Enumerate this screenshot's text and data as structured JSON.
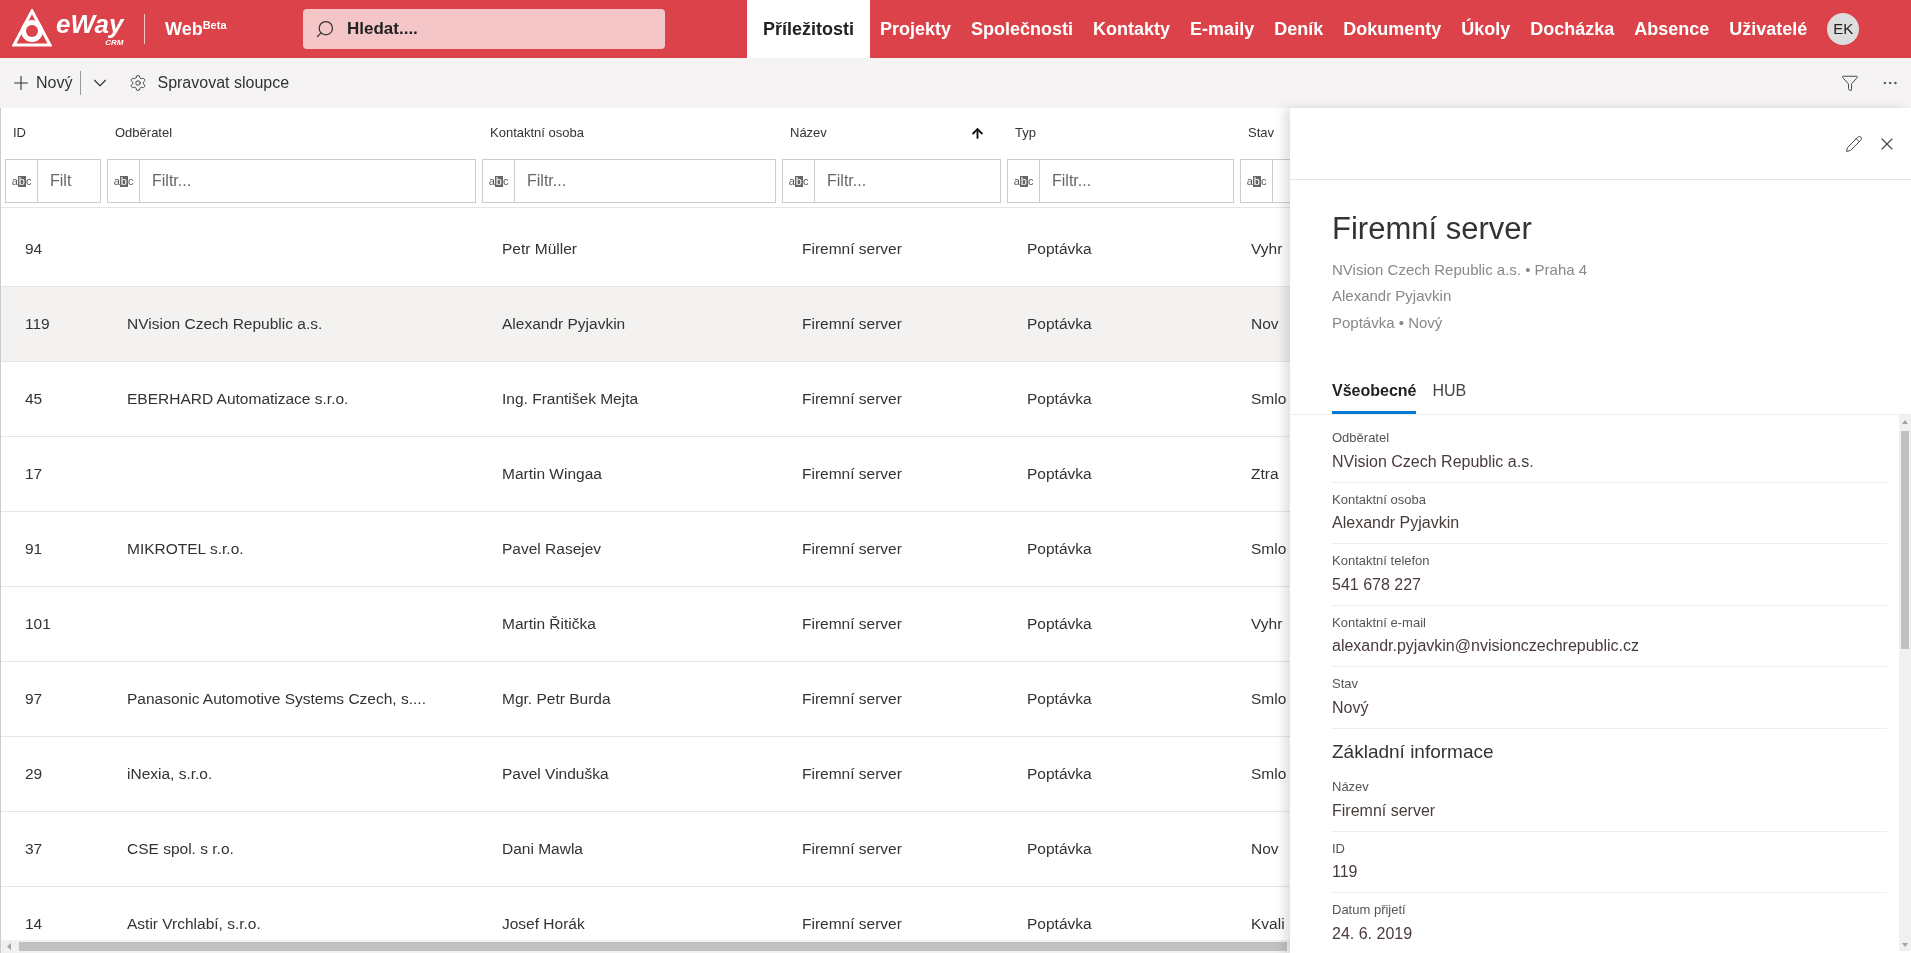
{
  "logo": {
    "name": "eWay",
    "sub": "CRM"
  },
  "product": "Web$^{Beta}$",
  "search": {
    "placeholder": "Hledat...."
  },
  "nav": [
    {
      "label": "Příležitosti",
      "selected": true
    },
    {
      "label": "Projekty",
      "selected": false
    },
    {
      "label": "Společnosti",
      "selected": false
    },
    {
      "label": "Kontakty",
      "selected": false
    },
    {
      "label": "E-maily",
      "selected": false
    },
    {
      "label": "Deník",
      "selected": false
    },
    {
      "label": "Dokumenty",
      "selected": false
    },
    {
      "label": "Úkoly",
      "selected": false
    },
    {
      "label": "Docházka",
      "selected": false
    },
    {
      "label": "Absence",
      "selected": false
    },
    {
      "label": "Uživatelé",
      "selected": false
    }
  ],
  "user": {
    "initials": "EK"
  },
  "toolbar": {
    "new": "Nový",
    "columns": "Spravovat sloupce"
  },
  "table": {
    "columns": [
      {
        "label": "ID",
        "sorted": false,
        "filter_icon": "abc",
        "placeholder": "Filt"
      },
      {
        "label": "Odběratel",
        "sorted": false,
        "filter_icon": "abc",
        "placeholder": "Filtr..."
      },
      {
        "label": "Kontaktní osoba",
        "sorted": false,
        "filter_icon": "abc",
        "placeholder": "Filtr..."
      },
      {
        "label": "Název",
        "sorted": true,
        "filter_icon": "abc",
        "placeholder": "Filtr..."
      },
      {
        "label": "Typ",
        "sorted": false,
        "filter_icon": "abc",
        "placeholder": "Filtr..."
      },
      {
        "label": "Stav",
        "sorted": false,
        "filter_icon": "abc"
      }
    ],
    "rows": [
      {
        "selected": false,
        "cells": [
          "94",
          "",
          "Petr Müller",
          "Firemní server",
          "Poptávka",
          "Vyhr"
        ]
      },
      {
        "selected": true,
        "cells": [
          "119",
          "NVision Czech Republic a.s.",
          "Alexandr Pyjavkin",
          "Firemní server",
          "Poptávka",
          "Nov"
        ]
      },
      {
        "selected": false,
        "cells": [
          "45",
          "EBERHARD Automatizace s.r.o.",
          "Ing. František Mejta",
          "Firemní server",
          "Poptávka",
          "Smlo"
        ]
      },
      {
        "selected": false,
        "cells": [
          "17",
          "",
          "Martin Wingaa",
          "Firemní server",
          "Poptávka",
          "Ztra"
        ]
      },
      {
        "selected": false,
        "cells": [
          "91",
          "MIKROTEL s.r.o.",
          "Pavel Rasejev",
          "Firemní server",
          "Poptávka",
          "Smlo"
        ]
      },
      {
        "selected": false,
        "cells": [
          "101",
          "",
          "Martin Řitička",
          "Firemní server",
          "Poptávka",
          "Vyhr"
        ]
      },
      {
        "selected": false,
        "cells": [
          "97",
          "Panasonic Automotive Systems Czech, s....",
          "Mgr. Petr Burda",
          "Firemní server",
          "Poptávka",
          "Smlo"
        ]
      },
      {
        "selected": false,
        "cells": [
          "29",
          "iNexia, s.r.o.",
          "Pavel Vinduška",
          "Firemní server",
          "Poptávka",
          "Smlo"
        ]
      },
      {
        "selected": false,
        "cells": [
          "37",
          "CSE spol. s r.o.",
          "Dani Mawla",
          "Firemní server",
          "Poptávka",
          "Nov"
        ]
      },
      {
        "selected": false,
        "cells": [
          "14",
          "Astir Vrchlabí, s.r.o.",
          "Josef Horák",
          "Firemní server",
          "Poptávka",
          "Kvali"
        ]
      }
    ]
  },
  "panel": {
    "title": "Firemní server",
    "subtitle": [
      "NVision Czech Republic a.s. • Praha 4",
      "Alexandr Pyjavkin",
      "Poptávka • Nový"
    ],
    "tabs": [
      {
        "label": "Všeobecné",
        "selected": true
      },
      {
        "label": "HUB",
        "selected": false
      }
    ],
    "items": [
      {
        "kind": "field",
        "label": "Odběratel",
        "value": "NVision Czech Republic a.s."
      },
      {
        "kind": "field",
        "label": "Kontaktní osoba",
        "value": "Alexandr Pyjavkin"
      },
      {
        "kind": "field",
        "label": "Kontaktní telefon",
        "value": "541 678 227"
      },
      {
        "kind": "field",
        "label": "Kontaktní e-mail",
        "value": "alexandr.pyjavkin@nvisionczechrepublic.cz"
      },
      {
        "kind": "field",
        "label": "Stav",
        "value": "Nový"
      },
      {
        "kind": "heading",
        "label": "Základní informace"
      },
      {
        "kind": "field",
        "label": "Název",
        "value": "Firemní server"
      },
      {
        "kind": "field",
        "label": "ID",
        "value": "119"
      },
      {
        "kind": "field",
        "label": "Datum přijetí",
        "value": "24. 6. 2019"
      }
    ]
  }
}
